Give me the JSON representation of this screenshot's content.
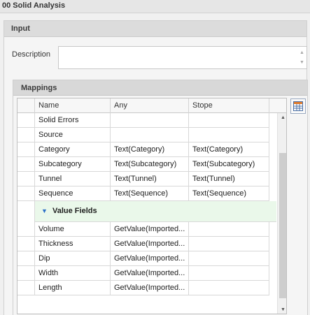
{
  "window": {
    "title": "00 Solid Analysis"
  },
  "input_section": {
    "title": "Input",
    "description_label": "Description",
    "description_value": ""
  },
  "mappings": {
    "title": "Mappings",
    "columns": [
      "Name",
      "Any",
      "Stope"
    ],
    "rows_top": [
      {
        "name": "Solid Errors",
        "any": "",
        "stope": ""
      },
      {
        "name": "Source",
        "any": "",
        "stope": ""
      },
      {
        "name": "Category",
        "any": "Text(Category)",
        "stope": "Text(Category)"
      },
      {
        "name": "Subcategory",
        "any": "Text(Subcategory)",
        "stope": "Text(Subcategory)"
      },
      {
        "name": "Tunnel",
        "any": "Text(Tunnel)",
        "stope": "Text(Tunnel)"
      },
      {
        "name": "Sequence",
        "any": "Text(Sequence)",
        "stope": "Text(Sequence)"
      }
    ],
    "group_label": "Value Fields",
    "rows_bottom": [
      {
        "name": "Volume",
        "any": "GetValue(Imported...",
        "stope": ""
      },
      {
        "name": "Thickness",
        "any": "GetValue(Imported...",
        "stope": ""
      },
      {
        "name": "Dip",
        "any": "GetValue(Imported...",
        "stope": ""
      },
      {
        "name": "Width",
        "any": "GetValue(Imported...",
        "stope": ""
      },
      {
        "name": "Length",
        "any": "GetValue(Imported...",
        "stope": ""
      }
    ],
    "side_button_icon": "grid-settings-icon"
  }
}
